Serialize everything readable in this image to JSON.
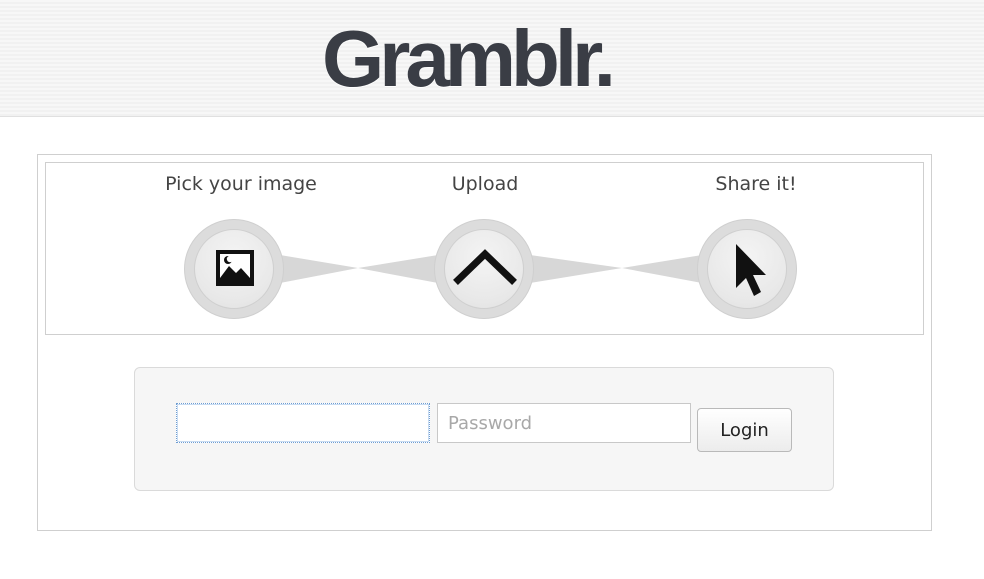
{
  "header": {
    "logo_text": "Gramblr."
  },
  "steps": [
    {
      "label": "Pick your image",
      "icon": "image-icon"
    },
    {
      "label": "Upload",
      "icon": "chevron-up-icon"
    },
    {
      "label": "Share it!",
      "icon": "cursor-arrow-icon"
    }
  ],
  "login": {
    "username_value": "",
    "username_placeholder": "",
    "password_placeholder": "Password",
    "login_label": "Login"
  }
}
